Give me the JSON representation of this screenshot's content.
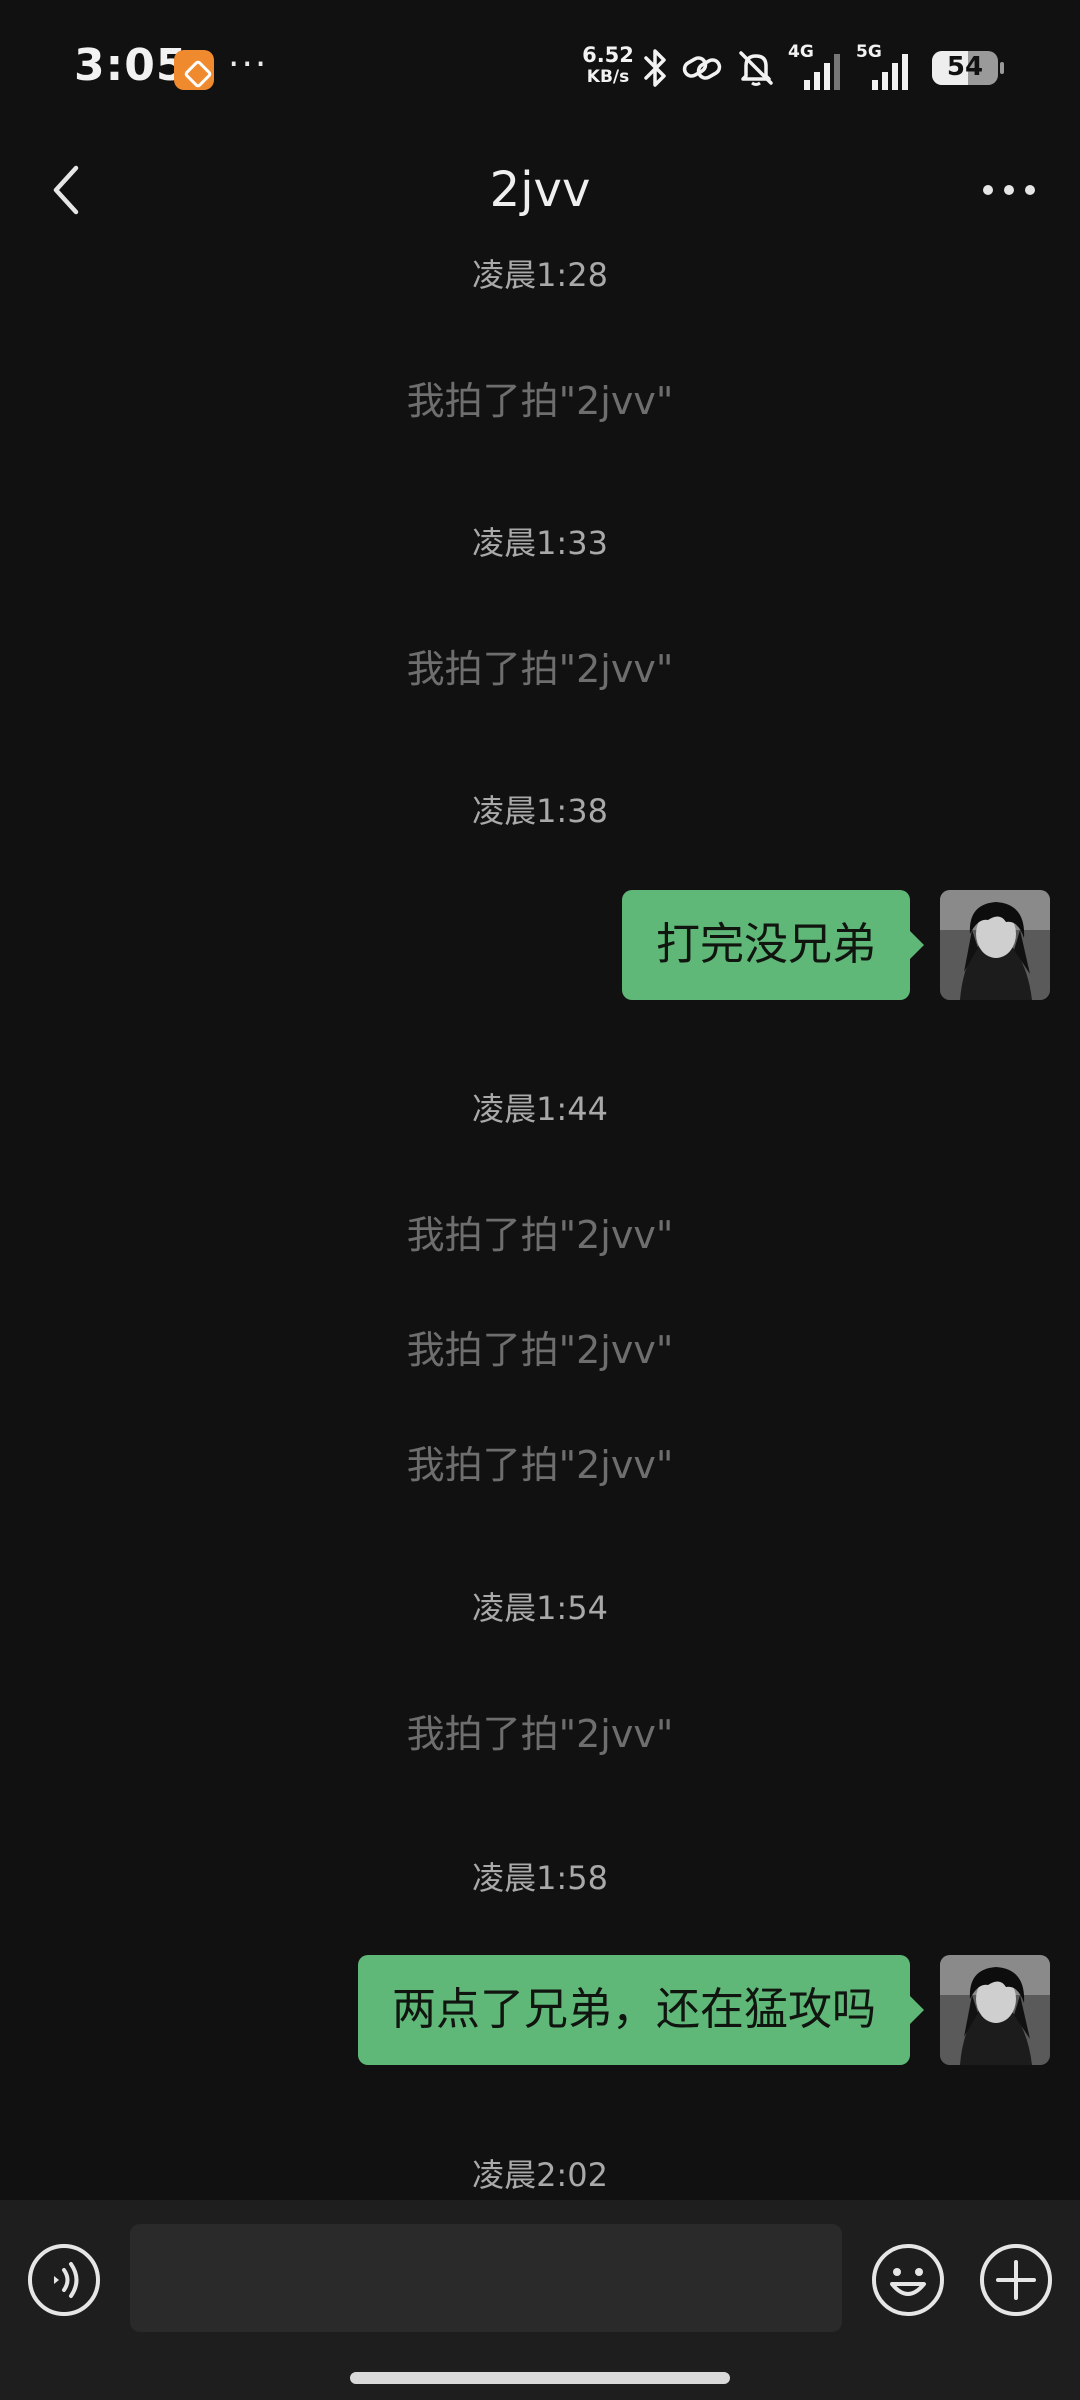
{
  "status_bar": {
    "time": "3:05",
    "more": "···",
    "net_speed_value": "6.52",
    "net_speed_unit": "KB/s",
    "signal_1_label": "4G",
    "signal_2_label": "5G",
    "battery": "54",
    "battery_level": 0.54
  },
  "header": {
    "title": "2jvv"
  },
  "messages": {
    "ts_1": "凌晨1:28",
    "pat_1": "我拍了拍\"2jvv\"",
    "ts_2": "凌晨1:33",
    "pat_2": "我拍了拍\"2jvv\"",
    "ts_3": "凌晨1:38",
    "bubble_1": "打完没兄弟",
    "ts_4": "凌晨1:44",
    "pat_3": "我拍了拍\"2jvv\"",
    "pat_4": "我拍了拍\"2jvv\"",
    "pat_5": "我拍了拍\"2jvv\"",
    "ts_5": "凌晨1:54",
    "pat_6": "我拍了拍\"2jvv\"",
    "ts_6": "凌晨1:58",
    "bubble_2": "两点了兄弟，还在猛攻吗",
    "ts_7": "凌晨2:02"
  },
  "input": {
    "value": "",
    "placeholder": ""
  },
  "colors": {
    "background": "#111111",
    "bubble": "#5fb878",
    "input_bar": "#1e1e1e"
  },
  "icons": {
    "back": "chevron-left-icon",
    "more": "more-dots-icon",
    "voice": "voice-icon",
    "emoji": "emoji-icon",
    "plus": "plus-icon"
  }
}
